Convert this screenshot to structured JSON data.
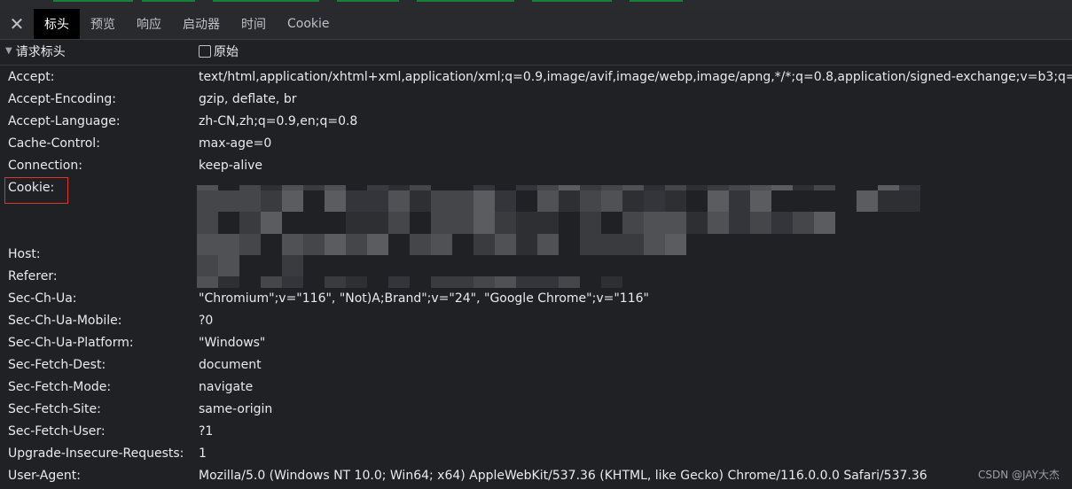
{
  "tabs": [
    {
      "label": "标头",
      "active": true
    },
    {
      "label": "预览"
    },
    {
      "label": "响应"
    },
    {
      "label": "启动器"
    },
    {
      "label": "时间"
    },
    {
      "label": "Cookie"
    }
  ],
  "section": {
    "title": "请求标头",
    "raw_label": "原始"
  },
  "headers": [
    {
      "name": "Accept:",
      "value": "text/html,application/xhtml+xml,application/xml;q=0.9,image/avif,image/webp,image/apng,*/*;q=0.8,application/signed-exchange;v=b3;q=0.7"
    },
    {
      "name": "Accept-Encoding:",
      "value": "gzip, deflate, br"
    },
    {
      "name": "Accept-Language:",
      "value": "zh-CN,zh;q=0.9,en;q=0.8"
    },
    {
      "name": "Cache-Control:",
      "value": "max-age=0"
    },
    {
      "name": "Connection:",
      "value": "keep-alive"
    },
    {
      "name": "Cookie:",
      "value": ""
    },
    {
      "name": "Host:",
      "value": ""
    },
    {
      "name": "Referer:",
      "value": ""
    },
    {
      "name": "Sec-Ch-Ua:",
      "value": "\"Chromium\";v=\"116\", \"Not)A;Brand\";v=\"24\", \"Google Chrome\";v=\"116\""
    },
    {
      "name": "Sec-Ch-Ua-Mobile:",
      "value": "?0"
    },
    {
      "name": "Sec-Ch-Ua-Platform:",
      "value": "\"Windows\""
    },
    {
      "name": "Sec-Fetch-Dest:",
      "value": "document"
    },
    {
      "name": "Sec-Fetch-Mode:",
      "value": "navigate"
    },
    {
      "name": "Sec-Fetch-Site:",
      "value": "same-origin"
    },
    {
      "name": "Sec-Fetch-User:",
      "value": "?1"
    },
    {
      "name": "Upgrade-Insecure-Requests:",
      "value": "1"
    },
    {
      "name": "User-Agent:",
      "value": "Mozilla/5.0 (Windows NT 10.0; Win64; x64) AppleWebKit/537.36 (KHTML, like Gecko) Chrome/116.0.0.0 Safari/537.36"
    }
  ],
  "watermark": "CSDN @JAY大杰",
  "colors": {
    "background": "#202124",
    "highlight_border": "#e0352b",
    "active_tab": "#000000"
  },
  "icons": {
    "close": "close-icon",
    "expand": "triangle-down-icon",
    "checkbox": "checkbox-icon"
  }
}
